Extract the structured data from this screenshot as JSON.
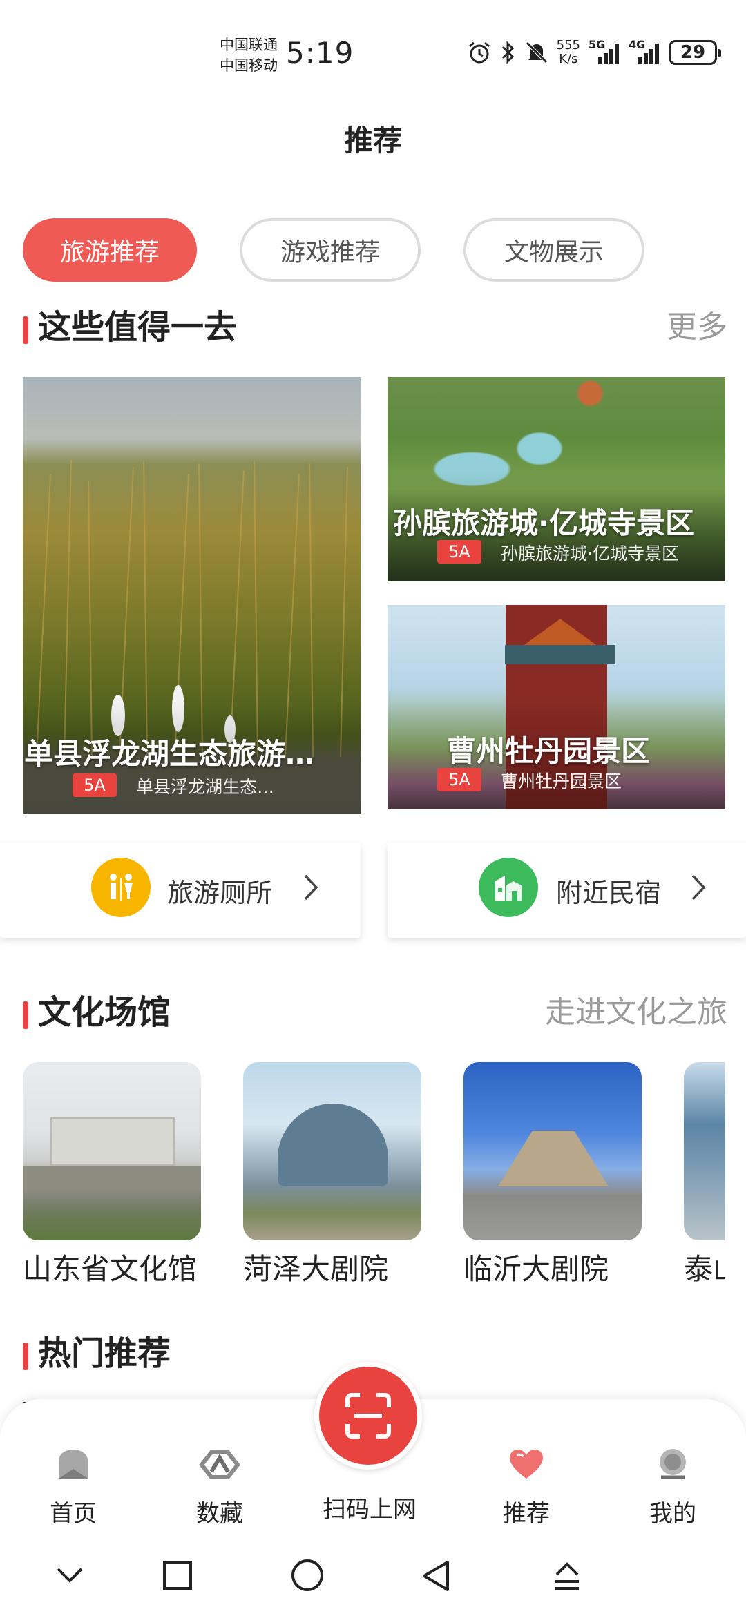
{
  "status_bar": {
    "carrier1": "中国联通",
    "carrier2": "中国移动",
    "time": "5:19",
    "net_speed_value": "555",
    "net_speed_unit": "K/s",
    "signal1_tag": "5G",
    "signal2_tag": "4G",
    "battery": "29",
    "icons": [
      "alarm-icon",
      "bluetooth-icon",
      "mute-icon"
    ]
  },
  "page": {
    "title": "推荐"
  },
  "tabs": [
    {
      "label": "旅游推荐",
      "active": true
    },
    {
      "label": "游戏推荐",
      "active": false
    },
    {
      "label": "文物展示",
      "active": false
    }
  ],
  "section_attractions": {
    "title": "这些值得一去",
    "more": "更多"
  },
  "attractions": [
    {
      "name": "单县浮龙湖生态旅游…",
      "badge": "5A",
      "sub": "单县浮龙湖生态…"
    },
    {
      "name": "孙膑旅游城·亿城寺景区",
      "badge": "5A",
      "sub": "孙膑旅游城·亿城寺景区"
    },
    {
      "name": "曹州牡丹园景区",
      "badge": "5A",
      "sub": "曹州牡丹园景区"
    }
  ],
  "services": [
    {
      "label": "旅游厕所",
      "icon": "toilet-icon",
      "color": "#f7b500"
    },
    {
      "label": "附近民宿",
      "icon": "homestay-icon",
      "color": "#3dbb5c"
    }
  ],
  "section_venues": {
    "title": "文化场馆",
    "more": "走进文化之旅"
  },
  "venues": [
    {
      "name": "山东省文化馆"
    },
    {
      "name": "菏泽大剧院"
    },
    {
      "name": "临沂大剧院"
    },
    {
      "name": "泰山"
    }
  ],
  "section_hot": {
    "title": "热门推荐"
  },
  "bottom_nav": {
    "items": [
      {
        "label": "首页",
        "icon": "home-icon"
      },
      {
        "label": "数藏",
        "icon": "collection-icon"
      },
      {
        "label": "扫码上网",
        "icon": "scan-icon"
      },
      {
        "label": "推荐",
        "icon": "heart-icon"
      },
      {
        "label": "我的",
        "icon": "profile-icon"
      }
    ]
  },
  "colors": {
    "accent": "#e8433e",
    "tab_active": "#f05a55",
    "muted": "#9a9a9a"
  }
}
